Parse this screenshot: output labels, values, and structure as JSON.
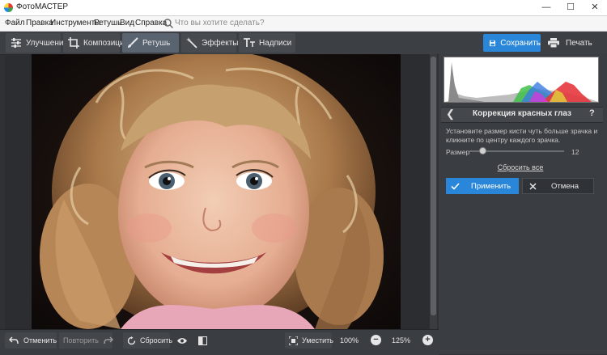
{
  "window": {
    "title": "ФотоМАСТЕР",
    "controls": [
      "minimize",
      "maximize",
      "close"
    ]
  },
  "menu": {
    "items": [
      "Файл",
      "Правка",
      "Инструменты",
      "Ретушь",
      "Вид",
      "Справка"
    ],
    "search_placeholder": "Что вы хотите сделать?"
  },
  "toolbar": {
    "tabs": [
      {
        "label": "Улучшения",
        "icon": "sliders-icon"
      },
      {
        "label": "Композиция",
        "icon": "crop-icon"
      },
      {
        "label": "Ретушь",
        "icon": "brush-icon",
        "active": true
      },
      {
        "label": "Эффекты",
        "icon": "magic-wand-icon"
      },
      {
        "label": "Надписи",
        "icon": "text-icon"
      }
    ],
    "save_label": "Сохранить",
    "print_label": "Печать"
  },
  "panel": {
    "title": "Коррекция красных глаз",
    "description": "Установите размер кисти чуть больше зрачка и кликните по центру каждого зрачка.",
    "size_label": "Размер",
    "size_value": "12",
    "reset_all": "Сбросить все",
    "apply_label": "Применить",
    "cancel_label": "Отмена"
  },
  "bottombar": {
    "undo_label": "Отменить",
    "redo_label": "Повторить",
    "reset_label": "Сбросить",
    "fit_label": "Уместить",
    "zoom_actual": "100%",
    "zoom_current": "125%"
  },
  "colors": {
    "accent": "#2a86d9",
    "toolbar_bg": "#3c3f43",
    "panel_bg": "#3a3d41"
  }
}
